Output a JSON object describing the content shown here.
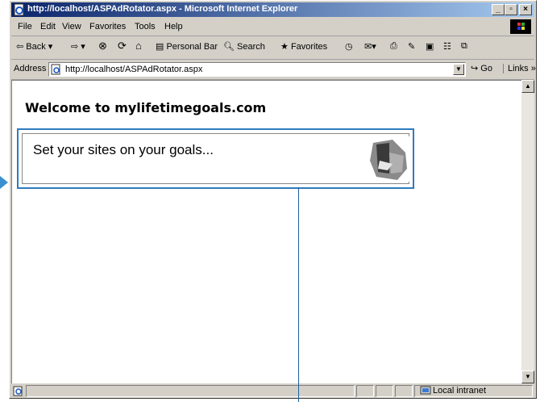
{
  "window": {
    "title": "http://localhost/ASPAdRotator.aspx - Microsoft Internet Explorer",
    "controls": [
      "_",
      "▫",
      "×"
    ]
  },
  "menu": [
    "File",
    "Edit",
    "View",
    "Favorites",
    "Tools",
    "Help"
  ],
  "toolbar": {
    "back": "Back",
    "personal_bar": "Personal Bar",
    "search": "Search",
    "favorites": "Favorites"
  },
  "address": {
    "label": "Address",
    "url": "http://localhost/ASPAdRotator.aspx",
    "go": "Go",
    "links": "Links »"
  },
  "page": {
    "heading": "Welcome to mylifetimegoals.com",
    "ad_text": "Set your sites on your goals..."
  },
  "status": {
    "zone": "Local intranet"
  },
  "colors": {
    "titlebar_start": "#0a246a",
    "callout": "#2e7cc0"
  }
}
